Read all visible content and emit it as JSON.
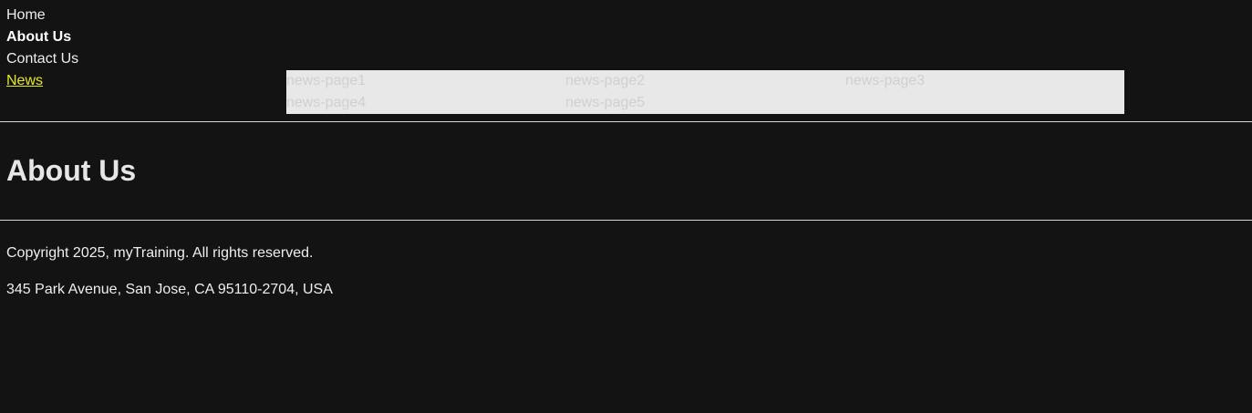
{
  "nav": {
    "items": [
      {
        "label": "Home"
      },
      {
        "label": "About Us"
      },
      {
        "label": "Contact Us"
      },
      {
        "label": "News"
      }
    ],
    "news_submenu": [
      {
        "label": "news-page1"
      },
      {
        "label": "news-page2"
      },
      {
        "label": "news-page3"
      },
      {
        "label": "news-page4"
      },
      {
        "label": "news-page5"
      }
    ]
  },
  "main": {
    "title": "About Us"
  },
  "footer": {
    "copyright": "Copyright 2025, myTraining. All rights reserved.",
    "address": "345 Park Avenue, San Jose, CA 95110-2704, USA"
  },
  "colors": {
    "background": "#131313",
    "text": "#eeeeee",
    "news_link_hover": "#e7e72a",
    "dropdown_background": "#e8e8e8"
  }
}
